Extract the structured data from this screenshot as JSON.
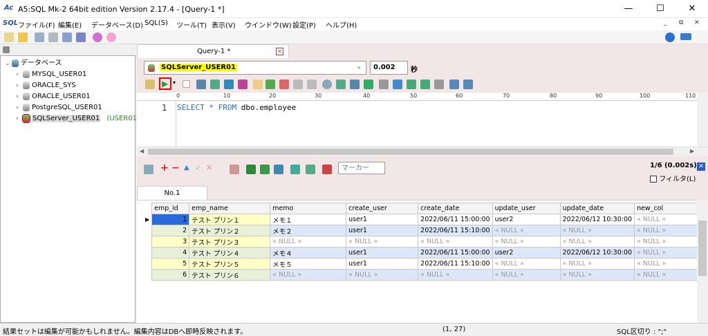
{
  "window": {
    "title": "A5:SQL Mk-2 64bit edition Version 2.17.4 - [Query-1 *]",
    "minimize": "—",
    "maximize": "☐",
    "close": "✕"
  },
  "app_logo": "Ac",
  "menu": [
    "SQL",
    "ファイル(F)",
    "編集(E)",
    "データベース(D)",
    "SQL(S)",
    "ツール(T)",
    "表示(V)",
    "ウインドウ(W)",
    "設定(P)",
    "ヘルプ(H)"
  ],
  "mdi_controls": [
    "_",
    "⧉",
    "✕"
  ],
  "tree": {
    "root": "データベース",
    "items": [
      {
        "label": "MYSQL_USER01"
      },
      {
        "label": "ORACLE_SYS"
      },
      {
        "label": "ORACLE_USER01"
      },
      {
        "label": "PostgreSQL_USER01"
      },
      {
        "label": "SQLServer_USER01",
        "suffix": "(USER01)"
      }
    ]
  },
  "editor": {
    "tab": "Query-1 *",
    "connection": "SQLServer_USER01",
    "elapsed": "0.002",
    "seconds_label": "秒",
    "line_no": "1",
    "sql_keywords": [
      "SELECT",
      "*",
      "FROM"
    ],
    "sql_table": "dbo.employee",
    "ruler": [
      "0",
      "10",
      "20",
      "30",
      "40",
      "50",
      "60",
      "70",
      "80",
      "90",
      "100",
      "110"
    ]
  },
  "results": {
    "marker_placeholder": "マーカー",
    "count": "1/6 (0.002s)",
    "filter_label": "フィルタ(L)",
    "tab": "No.1",
    "columns": [
      "emp_id",
      "emp_name",
      "memo",
      "create_user",
      "create_date",
      "update_user",
      "update_date",
      "new_col"
    ],
    "rows": [
      [
        "1",
        "テスト プリン１",
        "メモ１",
        "user1",
        "2022/06/11 15:00:00",
        "user2",
        "2022/06/12 10:30:00",
        "« NULL »"
      ],
      [
        "2",
        "テスト プリン２",
        "メモ２",
        "user1",
        "2022/06/11 15:10:00",
        "« NULL »",
        "« NULL »",
        "« NULL »"
      ],
      [
        "3",
        "テスト プリン３",
        "« NULL »",
        "« NULL »",
        "« NULL »",
        "« NULL »",
        "« NULL »",
        "« NULL »"
      ],
      [
        "4",
        "テスト プリン４",
        "メモ４",
        "user1",
        "2022/06/11 15:00:00",
        "user2",
        "2022/06/12 10:30:00",
        "« NULL »"
      ],
      [
        "5",
        "テスト プリン５",
        "メモ５",
        "user1",
        "2022/06/11 15:10:00",
        "« NULL »",
        "« NULL »",
        "« NULL »"
      ],
      [
        "6",
        "テスト プリン６",
        "« NULL »",
        "« NULL »",
        "« NULL »",
        "« NULL »",
        "« NULL »",
        "« NULL »"
      ]
    ]
  },
  "status": {
    "message": "結果セットは編集が可能かもしれません。編集内容はDBへ即時反映されます。",
    "position": "(1, 27)",
    "delimiter": "SQL区切り : \";\""
  }
}
